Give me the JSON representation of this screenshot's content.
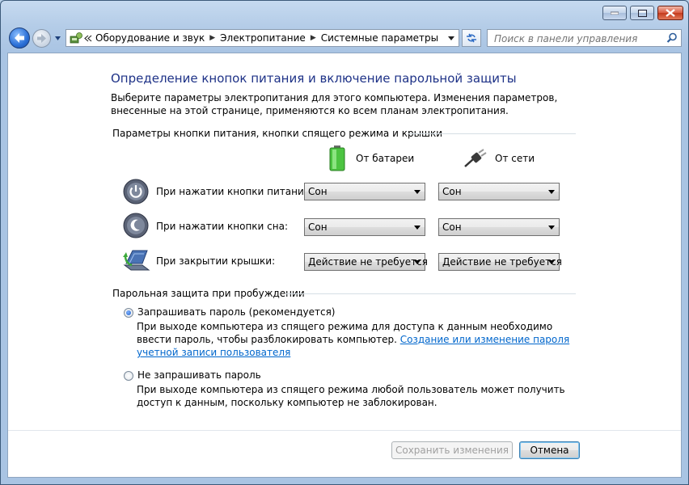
{
  "titlebar": {
    "buttons": [
      "minimize",
      "maximize",
      "close"
    ]
  },
  "nav": {
    "breadcrumbs": [
      "Оборудование и звук",
      "Электропитание",
      "Системные параметры"
    ],
    "search_placeholder": "Поиск в панели управления"
  },
  "page": {
    "title": "Определение кнопок питания и включение парольной защиты",
    "description": "Выберите параметры электропитания для этого компьютера. Изменения параметров, внесенные на этой странице, применяются ко всем планам электропитания."
  },
  "power_buttons": {
    "group_label": "Параметры кнопки питания, кнопки спящего режима и крышки",
    "col_battery": "От батареи",
    "col_ac": "От сети",
    "rows": [
      {
        "label": "При нажатии кнопки питания:",
        "battery": "Сон",
        "ac": "Сон"
      },
      {
        "label": "При нажатии кнопки сна:",
        "battery": "Сон",
        "ac": "Сон"
      },
      {
        "label": "При закрытии крышки:",
        "battery": "Действие не требуется",
        "ac": "Действие не требуется"
      }
    ]
  },
  "password": {
    "group_label": "Парольная защита при пробуждении",
    "option1": {
      "label": "Запрашивать пароль (рекомендуется)",
      "desc": "При выходе компьютера из спящего режима для доступа к данным необходимо ввести пароль, чтобы разблокировать компьютер.",
      "link": "Создание или изменение пароля учетной записи пользователя",
      "selected": true
    },
    "option2": {
      "label": "Не запрашивать пароль",
      "desc": "При выходе компьютера из спящего режима любой пользователь может получить доступ к данным, поскольку компьютер не заблокирован.",
      "selected": false
    }
  },
  "footer": {
    "save": "Сохранить изменения",
    "cancel": "Отмена"
  }
}
